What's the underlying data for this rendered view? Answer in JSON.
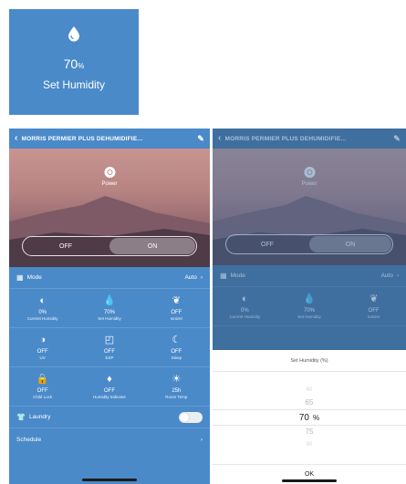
{
  "tile": {
    "icon": "water-drop-icon",
    "value": "70",
    "unit": "%",
    "caption": "Set Humidity"
  },
  "device_title": "MORRIS PERMIER PLUS DEHUMIDIFIE...",
  "power": {
    "label": "Power",
    "off_label": "OFF",
    "on_label": "ON",
    "state": "ON"
  },
  "mode": {
    "label": "Mode",
    "value": "Auto"
  },
  "grid": [
    {
      "icon": "moon-half-icon",
      "value": "0%",
      "label": "Current Humidity"
    },
    {
      "icon": "water-drop-icon",
      "value": "70%",
      "label": "Set Humidity"
    },
    {
      "icon": "leaf-icon",
      "value": "OFF",
      "label": "Ionizer"
    },
    {
      "icon": "contrast-icon",
      "value": "OFF",
      "label": "UV"
    },
    {
      "icon": "mug-icon",
      "value": "OFF",
      "label": "EXP"
    },
    {
      "icon": "crescent-moon-icon",
      "value": "OFF",
      "label": "Sleep"
    },
    {
      "icon": "lock-icon",
      "value": "OFF",
      "label": "Child Lock"
    },
    {
      "icon": "bulb-icon",
      "value": "OFF",
      "label": "Humidity Indicator"
    },
    {
      "icon": "sun-icon",
      "value": "25h",
      "label": "Room Temp"
    }
  ],
  "laundry": {
    "label": "Laundry",
    "enabled": false
  },
  "schedule": {
    "label": "Schedule"
  },
  "dialog": {
    "title": "Set Humidity (%)",
    "options": [
      "60",
      "65",
      "70",
      "75",
      "80"
    ],
    "selected": "70",
    "unit": "%",
    "ok_label": "OK"
  },
  "colors": {
    "panel": "#4a8ac9",
    "panel_dim": "#3f6f9f"
  }
}
